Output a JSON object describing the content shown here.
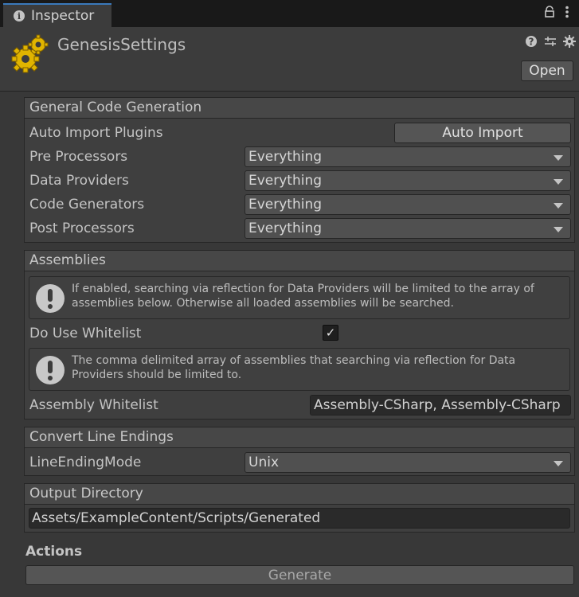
{
  "tab": {
    "title": "Inspector"
  },
  "header": {
    "asset_name": "GenesisSettings",
    "open_label": "Open"
  },
  "general": {
    "title": "General Code Generation",
    "auto_import_label": "Auto Import Plugins",
    "auto_import_button": "Auto Import",
    "rows": [
      {
        "label": "Pre Processors",
        "value": "Everything"
      },
      {
        "label": "Data Providers",
        "value": "Everything"
      },
      {
        "label": "Code Generators",
        "value": "Everything"
      },
      {
        "label": "Post Processors",
        "value": "Everything"
      }
    ]
  },
  "assemblies": {
    "title": "Assemblies",
    "help1": "If enabled, searching via reflection for Data Providers will be limited to the array of assemblies below. Otherwise all loaded assemblies will be searched.",
    "whitelist_toggle_label": "Do Use Whitelist",
    "whitelist_checked": true,
    "help2": "The comma delimited array of assemblies that searching via reflection for Data Providers should be limited to.",
    "whitelist_label": "Assembly Whitelist",
    "whitelist_value": "Assembly-CSharp, Assembly-CSharp"
  },
  "line_endings": {
    "title": "Convert Line Endings",
    "label": "LineEndingMode",
    "value": "Unix"
  },
  "output": {
    "title": "Output Directory",
    "value": "Assets/ExampleContent/Scripts/Generated"
  },
  "actions": {
    "title": "Actions",
    "generate_label": "Generate"
  },
  "icons": {
    "tab": "info-icon",
    "lock": "lock-icon",
    "menu": "kebab-menu-icon",
    "help": "help-icon",
    "preset": "preset-sliders-icon",
    "settings": "gear-icon",
    "asset": "scriptable-object-gears-icon"
  }
}
